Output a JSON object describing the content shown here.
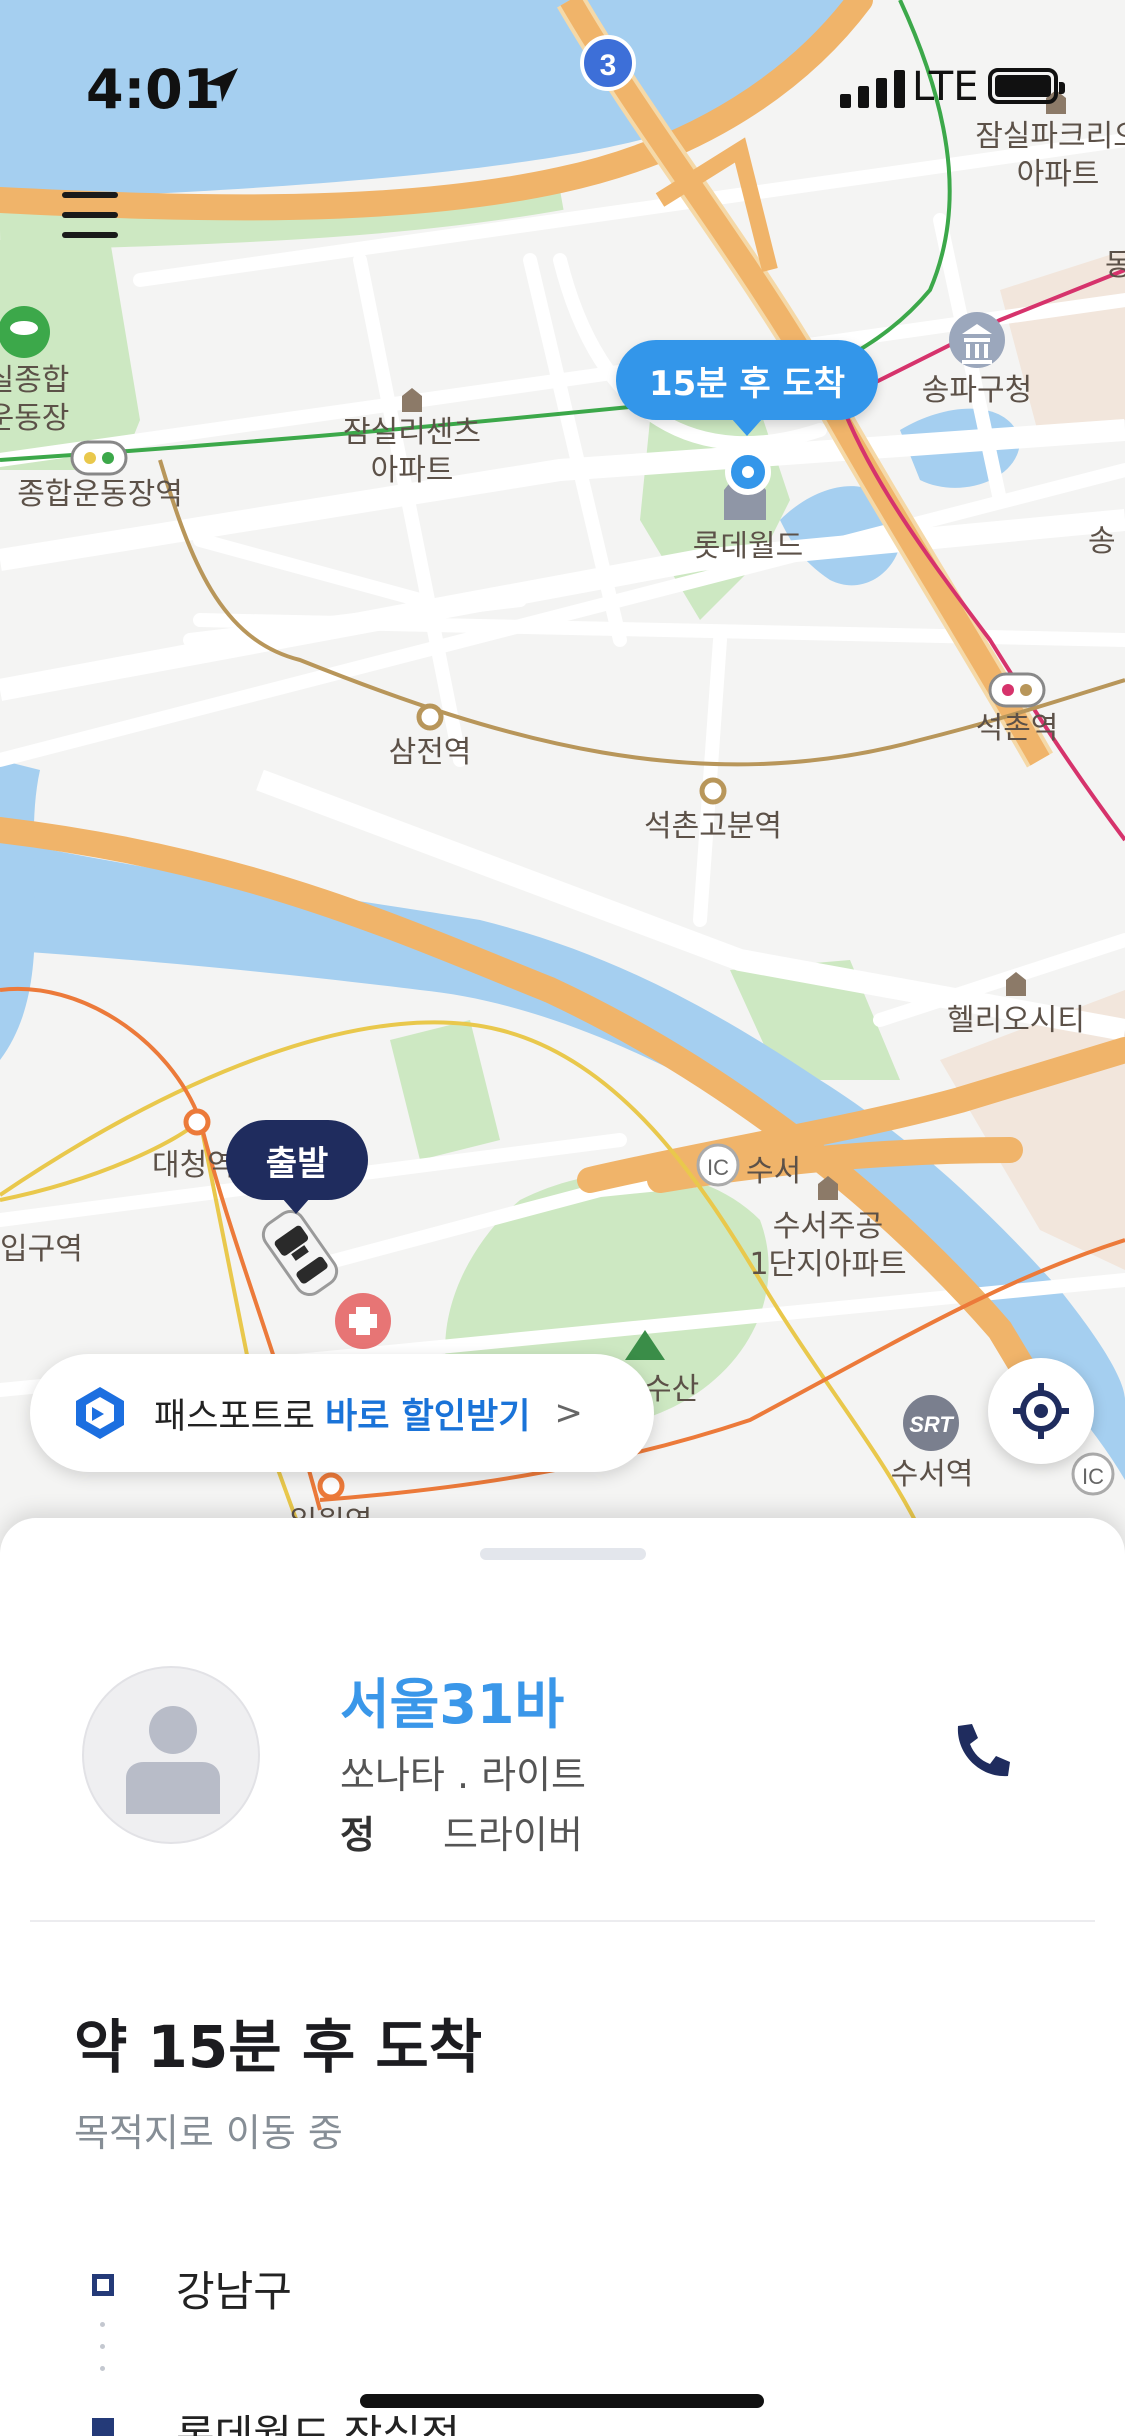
{
  "status_bar": {
    "time": "4:01",
    "network": "LTE"
  },
  "map": {
    "labels": {
      "jamsil_park": "잠실파크리오\n아파트",
      "songpa_office": "송파구청",
      "jamsil_sports": "종합운동장역",
      "jamsil_sports_complex": "실종합\n운동장",
      "jamsil_leaders": "잠실리센츠\n아파트",
      "lotte_world": "롯데월드",
      "samjeon": "삼전역",
      "seokchon_gobun": "석촌고분역",
      "seokchon": "석촌역",
      "heliocity": "헬리오시티",
      "daecheong": "대청역",
      "ilwon_entrance": "입구역",
      "suseo_ic": "수서",
      "suseo_apt": "수서주공\n1단지아파트",
      "suseo_station": "수서역",
      "mountain": "수산",
      "ilwon": "일원역",
      "partial_right": "송",
      "partial_top_right": "동",
      "route_number": "3",
      "ic": "IC",
      "srt": "SRT"
    },
    "arrival_bubble": "15분 후 도착",
    "departure_bubble": "출발"
  },
  "promo": {
    "prefix": "패스포트로",
    "highlight": "바로 할인받기",
    "chevron": ">"
  },
  "ride": {
    "plate": "서울31바",
    "car_model": "쏘나타 . 라이트",
    "driver_name": "정",
    "driver_role": "드라이버",
    "eta": "약 15분 후 도착",
    "status": "목적지로 이동 중",
    "origin": "강남구",
    "destination": "롯데월드 잠실점"
  },
  "colors": {
    "accent": "#3396ea",
    "navy": "#1f2c5e",
    "water": "#a5cff0",
    "road_major": "#f0b46a",
    "park": "#cde8c2"
  }
}
